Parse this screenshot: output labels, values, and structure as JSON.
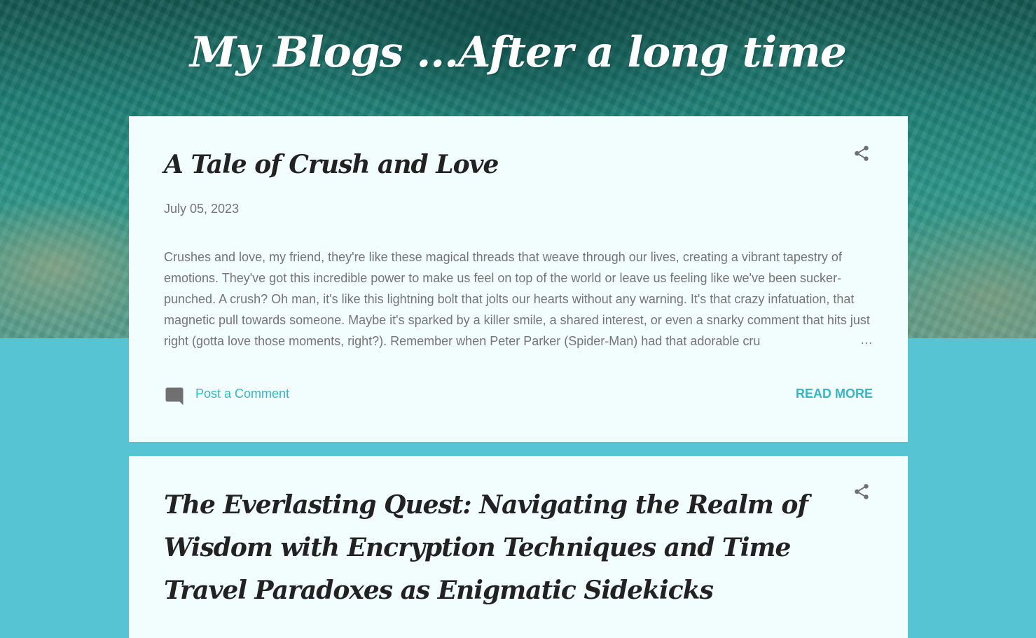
{
  "blog": {
    "title": "My Blogs ...After a long time"
  },
  "posts": [
    {
      "title": "A Tale of Crush and Love",
      "date": "July 05, 2023",
      "snippet": "Crushes and love, my friend, they're like these magical threads that weave through our lives, creating a vibrant tapestry of emotions. They've got this incredible power to make us feel on top of the world or leave us feeling like we've been sucker-punched. A crush? Oh man, it's like this lightning bolt that jolts our hearts without any warning. It's that crazy infatuation, that magnetic pull towards someone. Maybe it's sparked by a killer smile, a shared interest, or even a snarky comment that hits just right (gotta love those moments, right?). Remember when Peter Parker (Spider-Man) had that adorable cru",
      "ellipsis": "…",
      "comment_label": "Post a Comment",
      "read_more_label": "READ MORE"
    },
    {
      "title": "The Everlasting Quest: Navigating the Realm of Wisdom with Encryption Techniques and Time Travel Paradoxes as Enigmatic Sidekicks"
    }
  ],
  "colors": {
    "page_background": "#56c4d3",
    "card_background": "#f2fdfd",
    "link_accent": "#38b4c4",
    "muted_text": "#757575",
    "title_text": "#222222"
  },
  "icons": {
    "share": "share-icon",
    "comment": "comment-icon"
  }
}
